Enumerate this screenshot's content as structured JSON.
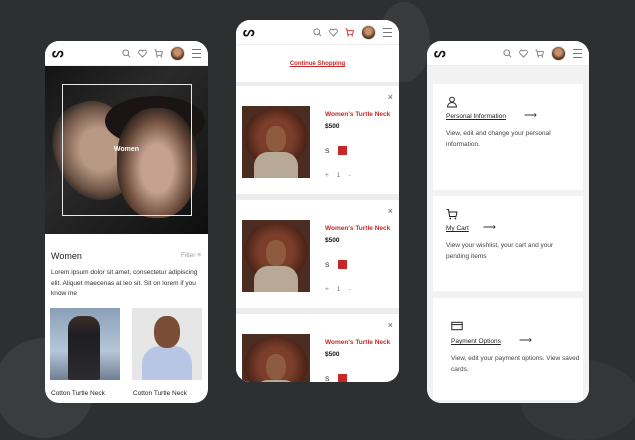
{
  "screen1": {
    "hero_label": "Women",
    "section_title": "Women",
    "filter_label": "Filter",
    "description": "Lorem ipsum dolor sit amet, consectetur adipiscing elit. Aliquet maecenas at leo sit. Sit on lorem if you know me",
    "products": [
      {
        "name": "Cotton Turtle Neck"
      },
      {
        "name": "Cotton Turtle Neck"
      }
    ]
  },
  "screen2": {
    "continue_label": "Continue Shopping",
    "items": [
      {
        "name": "Women's Turtle Neck",
        "price": "$500",
        "size": "S",
        "qty": "1",
        "minus": "-",
        "plus": "+"
      },
      {
        "name": "Women's Turtle Neck",
        "price": "$500",
        "size": "S",
        "qty": "1",
        "minus": "-",
        "plus": "+"
      },
      {
        "name": "Women's Turtle Neck",
        "price": "$500",
        "size": "S",
        "qty": "",
        "minus": "",
        "plus": ""
      }
    ],
    "close_symbol": "×"
  },
  "screen3": {
    "cards": [
      {
        "icon": "user-icon",
        "title": "Personal Information",
        "desc": "View, edit and change your personal information."
      },
      {
        "icon": "cart-icon",
        "title": "My Cart",
        "desc": "View your wishlist, your cart and your pending items"
      },
      {
        "icon": "card-icon",
        "title": "Payment Options",
        "desc": "View, edit your payment options. View saved cards."
      }
    ]
  },
  "colors": {
    "accent": "#c62828",
    "background": "#2e2f31"
  }
}
